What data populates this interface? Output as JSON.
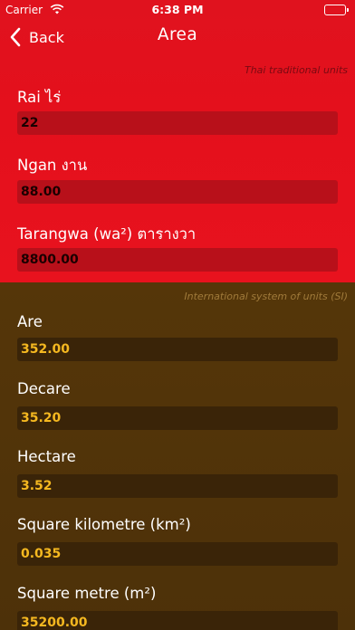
{
  "status_bar": {
    "carrier": "Carrier",
    "time": "6:38 PM",
    "wifi_icon": "wifi-icon",
    "battery_icon": "battery-icon"
  },
  "nav": {
    "back_label": "Back",
    "title": "Area"
  },
  "thai_section": {
    "caption": "Thai traditional units",
    "fields": [
      {
        "label": "Rai  ไร่",
        "value": "22"
      },
      {
        "label": "Ngan  งาน",
        "value": "88.00"
      },
      {
        "label": "Tarangwa (wa²)  ตารางวา",
        "value": "8800.00"
      }
    ]
  },
  "si_section": {
    "caption": "International system of units (SI)",
    "fields": [
      {
        "label": "Are",
        "value": "352.00"
      },
      {
        "label": "Decare",
        "value": "35.20"
      },
      {
        "label": "Hectare",
        "value": "3.52"
      },
      {
        "label": "Square kilometre (km²)",
        "value": "0.035"
      },
      {
        "label": "Square metre (m²)",
        "value": "35200.00"
      }
    ]
  },
  "colors": {
    "thai_background": "#e3111d",
    "thai_input": "#b8101a",
    "si_background": "#523409",
    "si_input": "#3a2408",
    "si_value_text": "#f5b820"
  }
}
